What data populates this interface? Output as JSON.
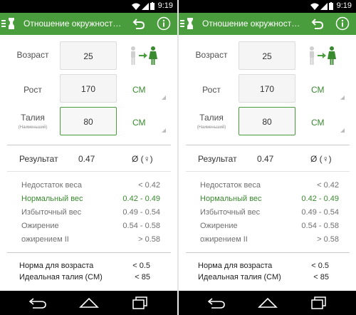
{
  "status": {
    "time": "9:19"
  },
  "appbar": {
    "title": "Отношение окружност…"
  },
  "form": {
    "age_label": "Возраст",
    "age_value": "25",
    "height_label": "Рост",
    "height_value": "170",
    "height_unit": "СМ",
    "waist_label": "Талия",
    "waist_sublabel": "(Наименьший)",
    "waist_value": "80",
    "waist_unit": "СМ"
  },
  "result": {
    "label": "Результат",
    "value": "0.47",
    "symbol": "Ø (♀)"
  },
  "categories": [
    {
      "label": "Недостаток веса",
      "range": "< 0.42",
      "highlight": false
    },
    {
      "label": "Нормальный вес",
      "range": "0.42 - 0.49",
      "highlight": true
    },
    {
      "label": "Избыточный вес",
      "range": "0.49 - 0.54",
      "highlight": false
    },
    {
      "label": "Ожирение",
      "range": "0.54 - 0.58",
      "highlight": false
    },
    {
      "label": "ожирением II",
      "range": "> 0.58",
      "highlight": false
    }
  ],
  "norms": [
    {
      "label": "Норма для возраста",
      "value": "< 0.5"
    },
    {
      "label": "Идеальная талия (СМ)",
      "value": "< 85"
    }
  ],
  "colors": {
    "accent": "#4a9d3c",
    "highlight": "#3a8a30",
    "statusbar": "#000000"
  },
  "icons": [
    "menu-icon",
    "app-logo-icon",
    "back-icon",
    "info-icon",
    "gender-switch-icon",
    "wifi-icon",
    "signal-icon",
    "battery-icon",
    "nav-back-icon",
    "nav-home-icon",
    "nav-recents-icon"
  ]
}
